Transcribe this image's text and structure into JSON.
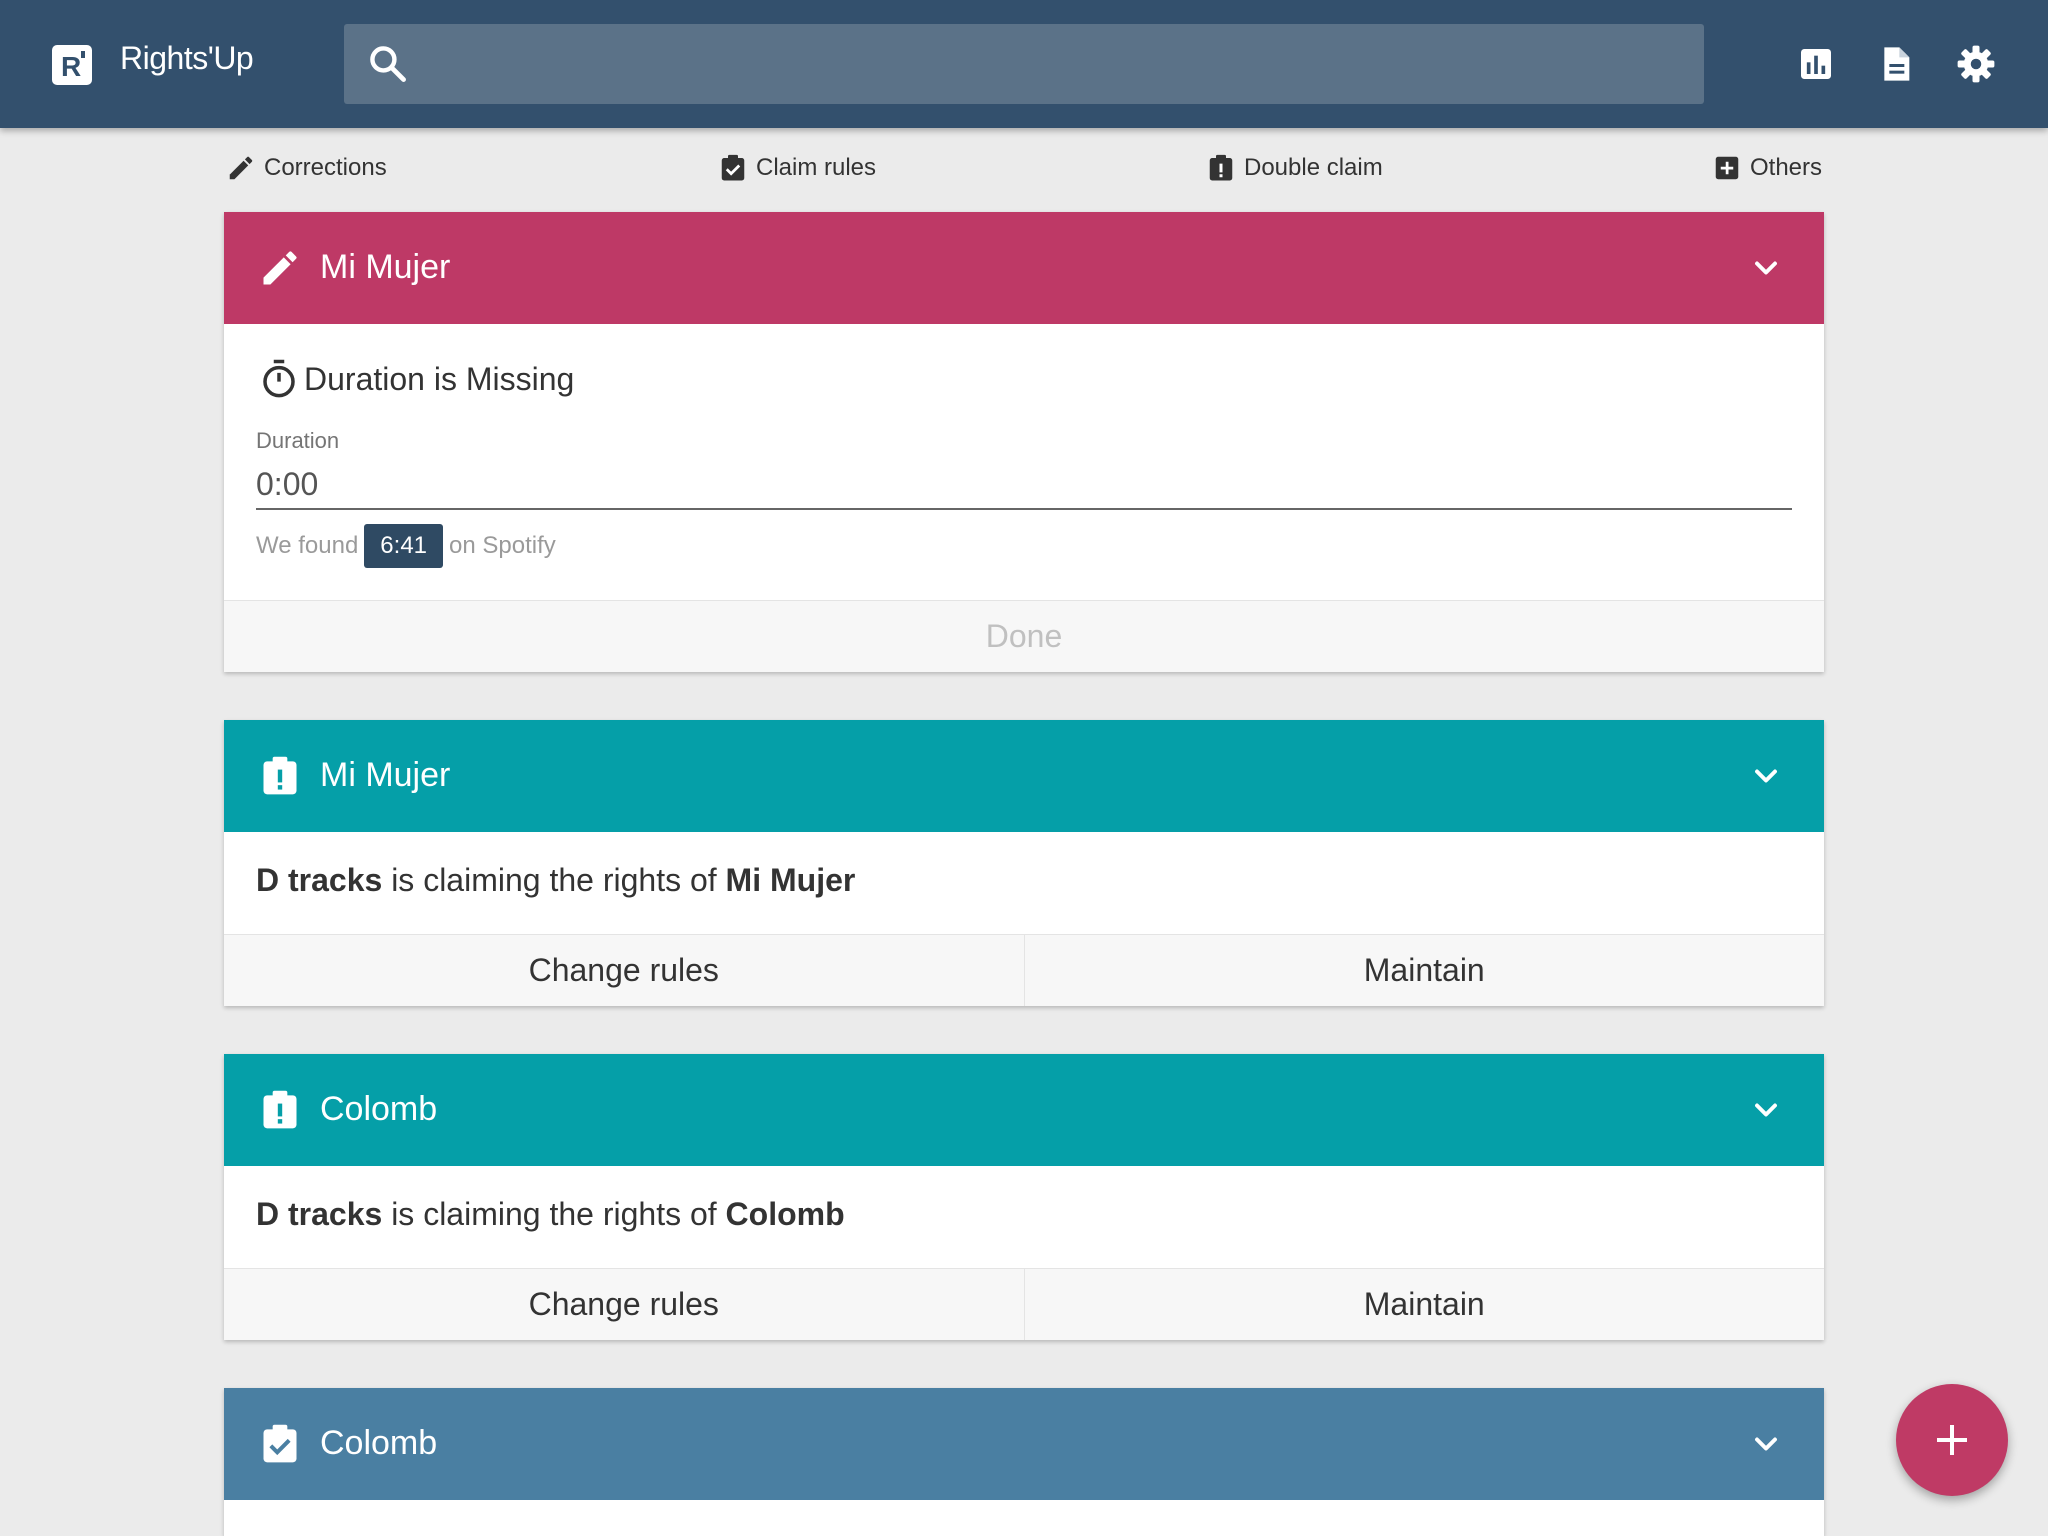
{
  "app": {
    "logo_letter": "R",
    "name": "Rights'Up"
  },
  "search": {
    "placeholder": "",
    "value": ""
  },
  "toolbar": {
    "icons": [
      "bar-chart-icon",
      "document-icon",
      "gear-icon"
    ]
  },
  "tabs": [
    {
      "label": "Corrections",
      "icon": "pencil-icon"
    },
    {
      "label": "Claim rules",
      "icon": "clipboard-check-icon"
    },
    {
      "label": "Double claim",
      "icon": "clipboard-alert-icon"
    },
    {
      "label": "Others",
      "icon": "plus-box-icon"
    }
  ],
  "colors": {
    "appbar": "#33506d",
    "correction": "#be3966",
    "double_claim": "#059fa8",
    "claim_rule": "#4a7fa2",
    "fab": "#bf3a65"
  },
  "cards": [
    {
      "type": "correction",
      "title": "Mi Mujer",
      "icon": "pencil-icon",
      "issue": "Duration is Missing",
      "issue_icon": "stopwatch-icon",
      "field_label": "Duration",
      "field_value": "0:00",
      "found_prefix": "We found",
      "found_value": "6:41",
      "found_suffix": "on Spotify",
      "action": "Done"
    },
    {
      "type": "double_claim",
      "title": "Mi Mujer",
      "icon": "clipboard-alert-icon",
      "claimant": "D tracks",
      "claim_middle": "is claiming the rights of",
      "work": "Mi Mujer",
      "actions": [
        "Change rules",
        "Maintain"
      ]
    },
    {
      "type": "double_claim",
      "title": "Colomb",
      "icon": "clipboard-alert-icon",
      "claimant": "D tracks",
      "claim_middle": "is claiming the rights of",
      "work": "Colomb",
      "actions": [
        "Change rules",
        "Maintain"
      ]
    },
    {
      "type": "claim_rule",
      "title": "Colomb",
      "icon": "clipboard-check-icon"
    }
  ],
  "fab": {
    "label": "+",
    "icon": "plus-icon"
  }
}
